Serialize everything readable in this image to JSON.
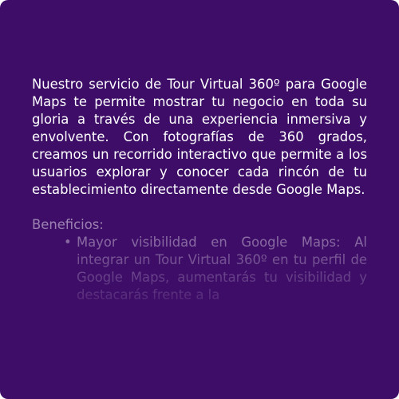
{
  "panel": {
    "background": "#3e0d68",
    "intro_text": "Nuestro servicio de Tour Virtual 360º para Google Maps te permite mostrar tu negocio en toda su gloria a través de una experiencia inmersiva y envolvente. Con fotografías de 360 grados, creamos un recorrido interactivo que permite a los usuarios explorar y conocer cada rincón de tu establecimiento directamente desde Google Maps.",
    "benefits_heading": "Beneficios:",
    "benefits": [
      {
        "text": "Mayor visibilidad en Google Maps: Al integrar un Tour Virtual 360º en tu perfil de Google Maps, aumentarás tu visibilidad y destacarás frente a la"
      }
    ]
  }
}
